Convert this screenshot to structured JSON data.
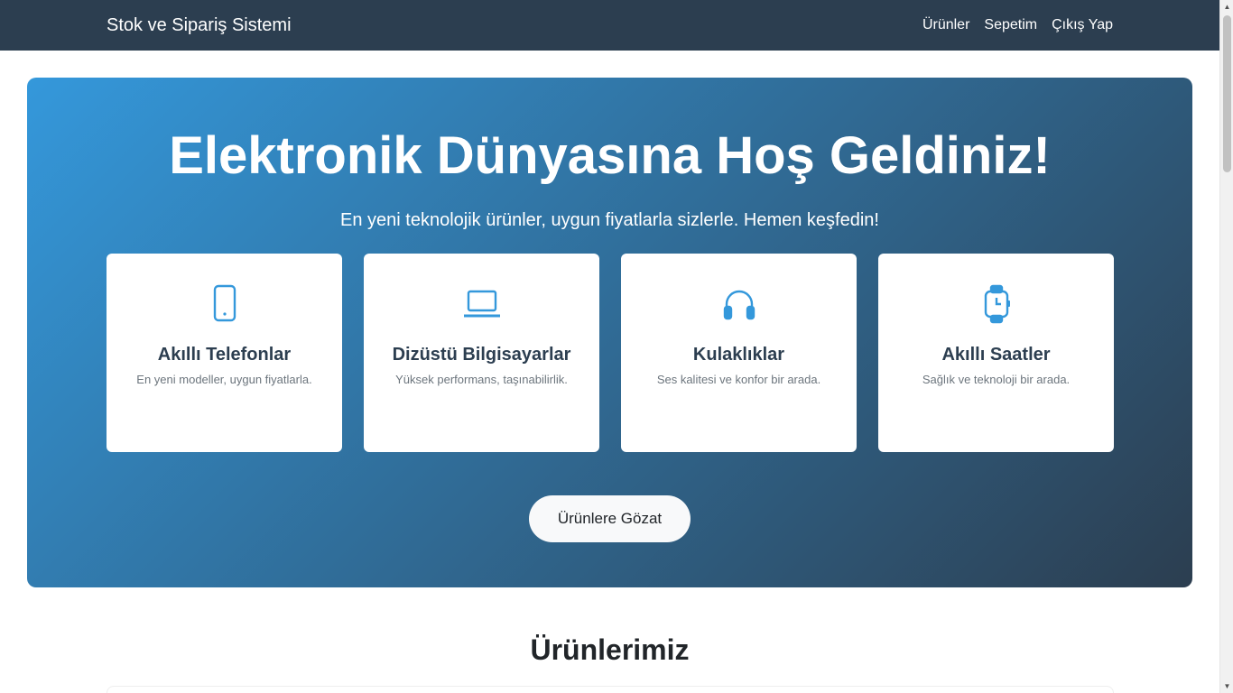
{
  "navbar": {
    "brand": "Stok ve Sipariş Sistemi",
    "links": [
      "Ürünler",
      "Sepetim",
      "Çıkış Yap"
    ]
  },
  "hero": {
    "title": "Elektronik Dünyasına Hoş Geldiniz!",
    "subtitle": "En yeni teknolojik ürünler, uygun fiyatlarla sizlerle. Hemen keşfedin!",
    "cards": [
      {
        "icon": "smartphone-icon",
        "title": "Akıllı Telefonlar",
        "description": "En yeni modeller, uygun fiyatlarla."
      },
      {
        "icon": "laptop-icon",
        "title": "Dizüstü Bilgisayarlar",
        "description": "Yüksek performans, taşınabilirlik."
      },
      {
        "icon": "headphones-icon",
        "title": "Kulaklıklar",
        "description": "Ses kalitesi ve konfor bir arada."
      },
      {
        "icon": "smartwatch-icon",
        "title": "Akıllı Saatler",
        "description": "Sağlık ve teknoloji bir arada."
      }
    ],
    "button_label": "Ürünlere Gözat"
  },
  "products_section": {
    "title": "Ürünlerimiz"
  },
  "colors": {
    "navbar": "#2c3e50",
    "accent": "#3498db",
    "gradient_end": "#2c3e50",
    "card_title": "#2c3e50"
  }
}
